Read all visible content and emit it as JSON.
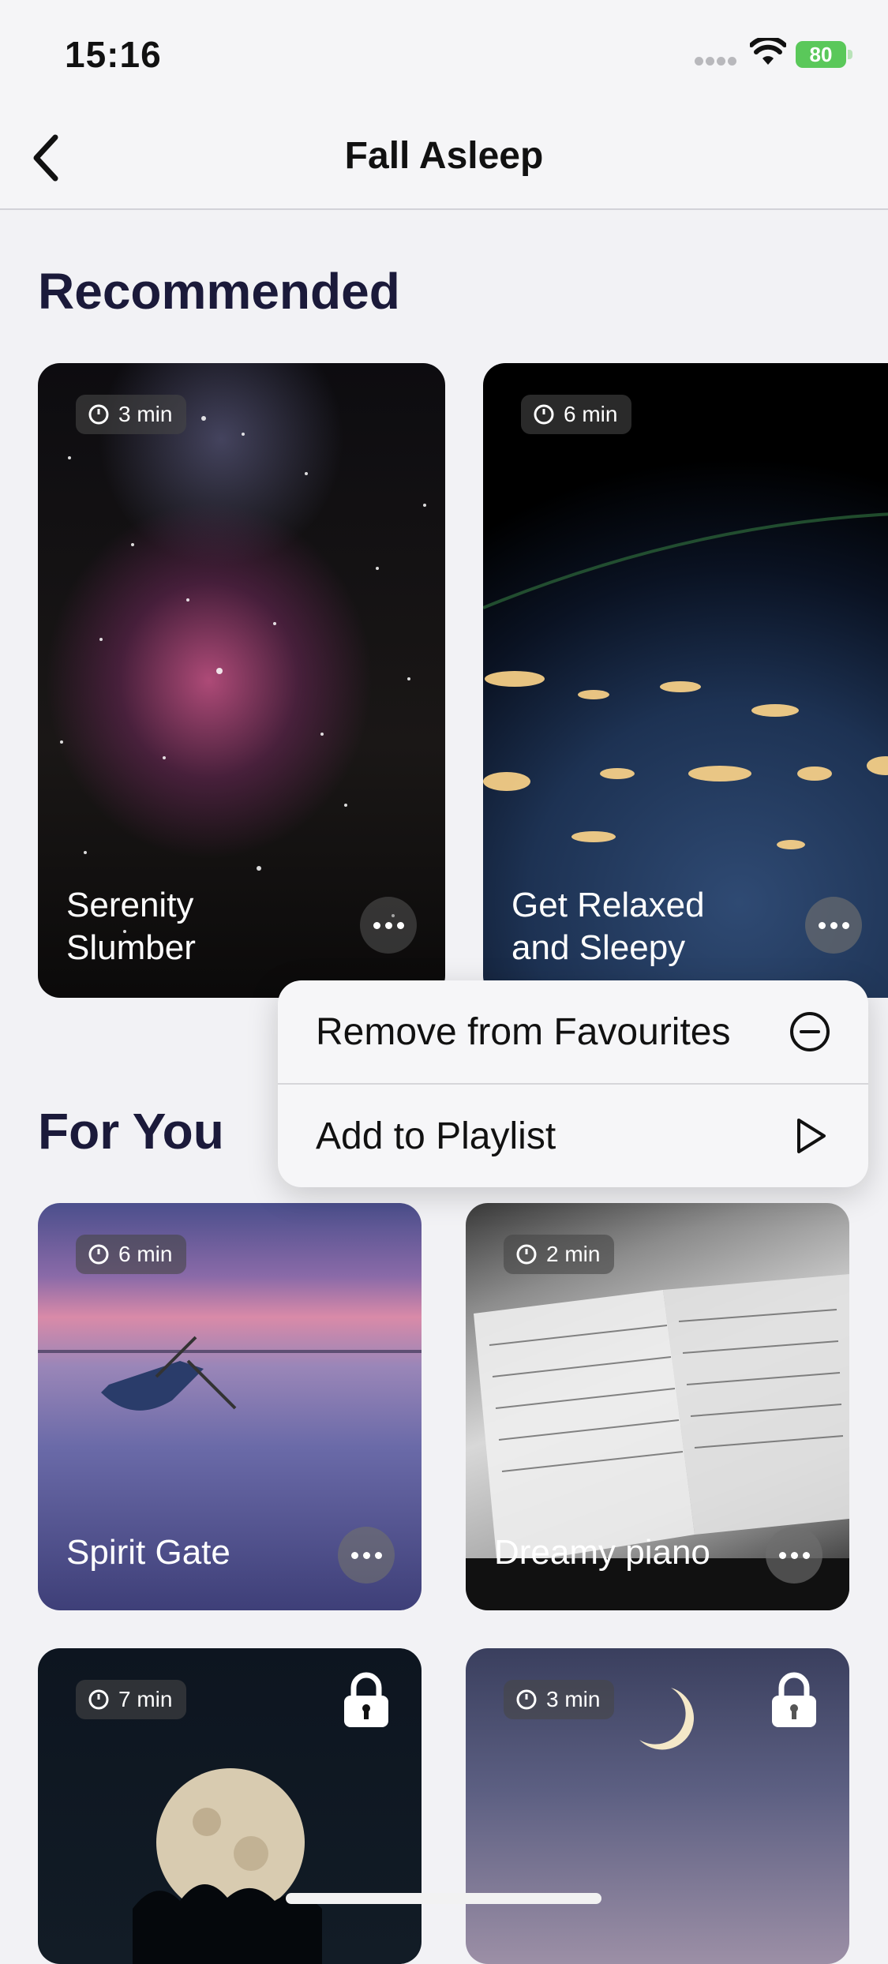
{
  "status_bar": {
    "time": "15:16",
    "battery": "80"
  },
  "nav": {
    "title": "Fall Asleep"
  },
  "sections": {
    "recommended": "Recommended",
    "for_you": "For You"
  },
  "recommended": [
    {
      "duration": "3 min",
      "title_line1": "Serenity",
      "title_line2": "Slumber"
    },
    {
      "duration": "6 min",
      "title_line1": "Get Relaxed",
      "title_line2": "and Sleepy"
    }
  ],
  "for_you": [
    {
      "duration": "6 min",
      "title": "Spirit Gate"
    },
    {
      "duration": "2 min",
      "title": "Dreamy piano"
    },
    {
      "duration": "7 min",
      "title": ""
    },
    {
      "duration": "3 min",
      "title": ""
    }
  ],
  "context_menu": {
    "remove_label": "Remove from Favourites",
    "playlist_label": "Add to Playlist"
  }
}
